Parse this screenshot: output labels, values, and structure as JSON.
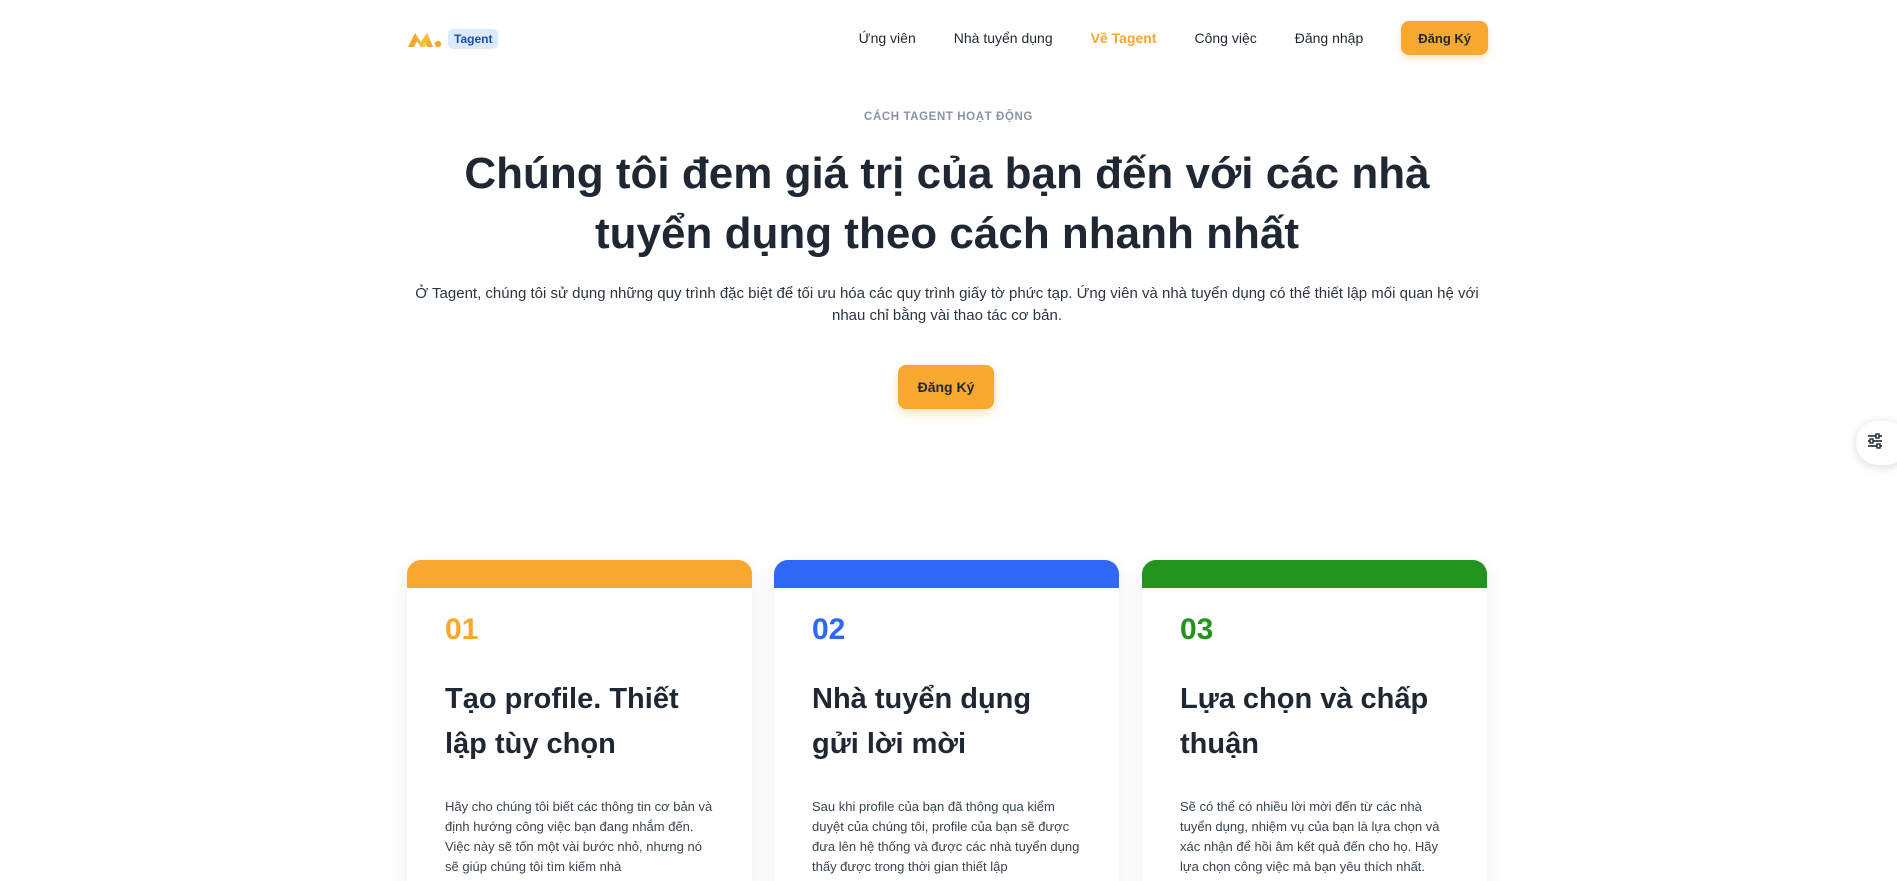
{
  "nav": {
    "logo_badge": "Tagent",
    "links": [
      "Ứng viên",
      "Nhà tuyển dụng",
      "Về Tagent",
      "Công việc",
      "Đăng nhập"
    ],
    "active_index": 2,
    "cta": "Đăng Ký"
  },
  "hero": {
    "eyebrow": "CÁCH TAGENT HOẠT ĐỘNG",
    "title": "Chúng tôi đem giá trị của bạn đến với các nhà tuyển dụng theo cách nhanh nhất",
    "description": "Ở Tagent, chúng tôi sử dụng những quy trình đặc biệt để tối ưu hóa các quy trình giấy tờ phức tạp. Ứng viên và nhà tuyển dụng có thể thiết lập mối quan hệ với nhau chỉ bằng vài thao tác cơ bản.",
    "cta": "Đăng Ký"
  },
  "cards": [
    {
      "number": "01",
      "title": "Tạo profile. Thiết lập tùy chọn",
      "text": "Hãy cho chúng tôi biết các thông tin cơ bản và định hướng công việc bạn đang nhắm đến. Việc này sẽ tốn một vài bước nhỏ, nhưng nó sẽ giúp chúng tôi tìm kiếm nhà",
      "color": "#f8a72f"
    },
    {
      "number": "02",
      "title": "Nhà tuyển dụng gửi lời mời",
      "text": "Sau khi profile của bạn đã thông qua kiểm duyệt của chúng tôi, profile của bạn sẽ được đưa lên hệ thống và được các nhà tuyển dụng thấy được trong thời gian thiết lập",
      "color": "#2f67f6"
    },
    {
      "number": "03",
      "title": "Lựa chọn và chấp thuận",
      "text": "Sẽ có thể có nhiều lời mời đến từ các nhà tuyển dụng, nhiệm vụ của bạn là lựa chọn và xác nhận để hồi âm kết quả đến cho họ. Hãy lựa chọn công việc mà bạn yêu thích nhất.",
      "color": "#22931c"
    }
  ],
  "icons": {
    "logo": "tagent-logo-mark",
    "fab": "sliders-icon"
  }
}
